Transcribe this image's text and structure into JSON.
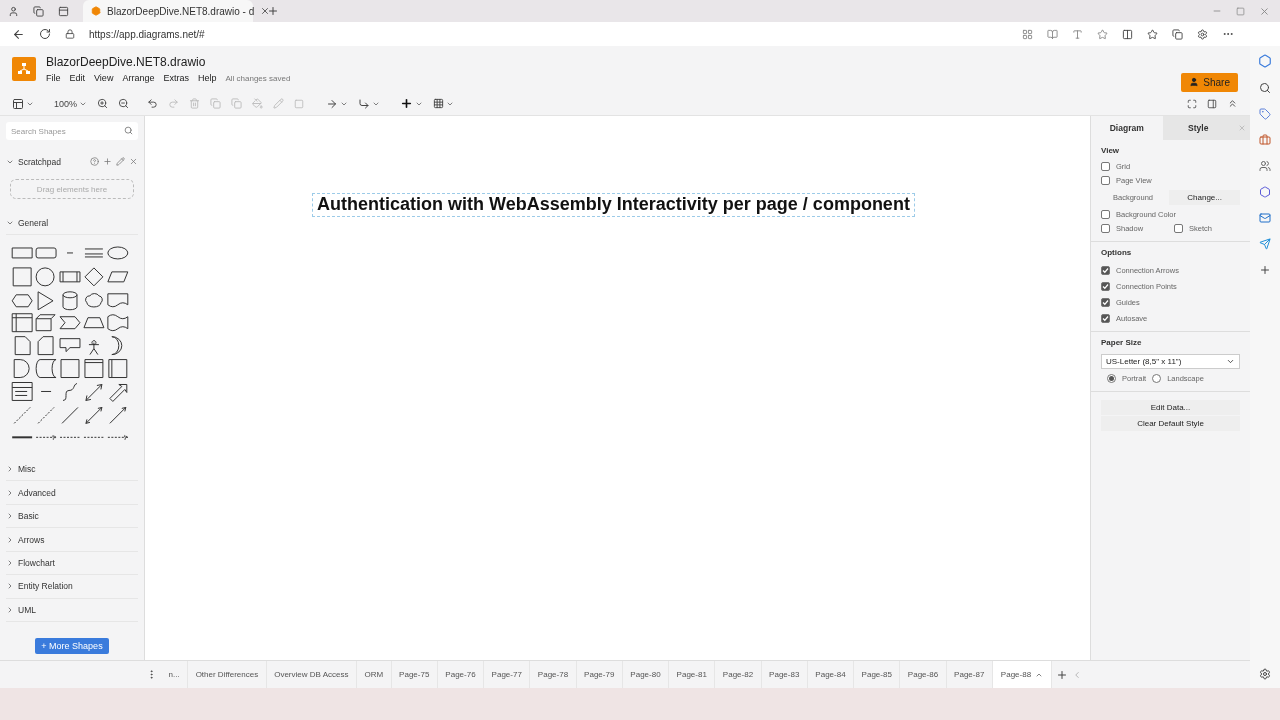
{
  "browser": {
    "tabs": [
      {
        "title": "BlazorDeepDive.NET8.drawio - d",
        "selected": true
      }
    ],
    "url": "https://app.diagrams.net/#"
  },
  "app": {
    "title": "BlazorDeepDive.NET8.drawio",
    "menu": [
      "File",
      "Edit",
      "View",
      "Arrange",
      "Extras",
      "Help"
    ],
    "status": "All changes saved",
    "share": "Share"
  },
  "toolbar": {
    "zoom": "100%"
  },
  "sidebar": {
    "search": {
      "placeholder": "Search Shapes"
    },
    "scratchpad": {
      "title": "Scratchpad",
      "expanded": true,
      "hint": "Drag elements here"
    },
    "sections": [
      {
        "label": "General",
        "expanded": true
      },
      {
        "label": "Misc",
        "expanded": false
      },
      {
        "label": "Advanced",
        "expanded": false
      },
      {
        "label": "Basic",
        "expanded": false
      },
      {
        "label": "Arrows",
        "expanded": false
      },
      {
        "label": "Flowchart",
        "expanded": false
      },
      {
        "label": "Entity Relation",
        "expanded": false
      },
      {
        "label": "UML",
        "expanded": false
      }
    ],
    "more_shapes": "+ More Shapes"
  },
  "canvas": {
    "text": "Authentication with WebAssembly Interactivity per page / component",
    "selected": true
  },
  "format_panel": {
    "tabs": [
      {
        "label": "Diagram",
        "selected": true
      },
      {
        "label": "Style",
        "selected": false
      }
    ],
    "view": {
      "heading": "View",
      "grid": {
        "label": "Grid",
        "checked": false
      },
      "page_view": {
        "label": "Page View",
        "checked": false
      },
      "background": {
        "label": "Background",
        "button": "Change..."
      },
      "background_color": {
        "label": "Background Color",
        "checked": false
      },
      "shadow": {
        "label": "Shadow",
        "checked": false
      },
      "sketch": {
        "label": "Sketch",
        "checked": false
      }
    },
    "options": {
      "heading": "Options",
      "items": [
        {
          "label": "Connection Arrows",
          "checked": true
        },
        {
          "label": "Connection Points",
          "checked": true
        },
        {
          "label": "Guides",
          "checked": true
        },
        {
          "label": "Autosave",
          "checked": true
        }
      ]
    },
    "paper_size": {
      "heading": "Paper Size",
      "value": "US-Letter (8,5\" x 11\")",
      "orientation": [
        {
          "label": "Portrait",
          "selected": true
        },
        {
          "label": "Landscape",
          "selected": false
        }
      ]
    },
    "buttons": [
      "Edit Data...",
      "Clear Default Style"
    ]
  },
  "page_tabs": [
    {
      "label": "n...",
      "selected": false
    },
    {
      "label": "Other Differences",
      "selected": false
    },
    {
      "label": "Overview DB Access",
      "selected": false
    },
    {
      "label": "ORM",
      "selected": false
    },
    {
      "label": "Page-75",
      "selected": false
    },
    {
      "label": "Page-76",
      "selected": false
    },
    {
      "label": "Page-77",
      "selected": false
    },
    {
      "label": "Page-78",
      "selected": false
    },
    {
      "label": "Page-79",
      "selected": false
    },
    {
      "label": "Page-80",
      "selected": false
    },
    {
      "label": "Page-81",
      "selected": false
    },
    {
      "label": "Page-82",
      "selected": false
    },
    {
      "label": "Page-83",
      "selected": false
    },
    {
      "label": "Page-84",
      "selected": false
    },
    {
      "label": "Page-85",
      "selected": false
    },
    {
      "label": "Page-86",
      "selected": false
    },
    {
      "label": "Page-87",
      "selected": false
    },
    {
      "label": "Page-88",
      "selected": true
    }
  ]
}
